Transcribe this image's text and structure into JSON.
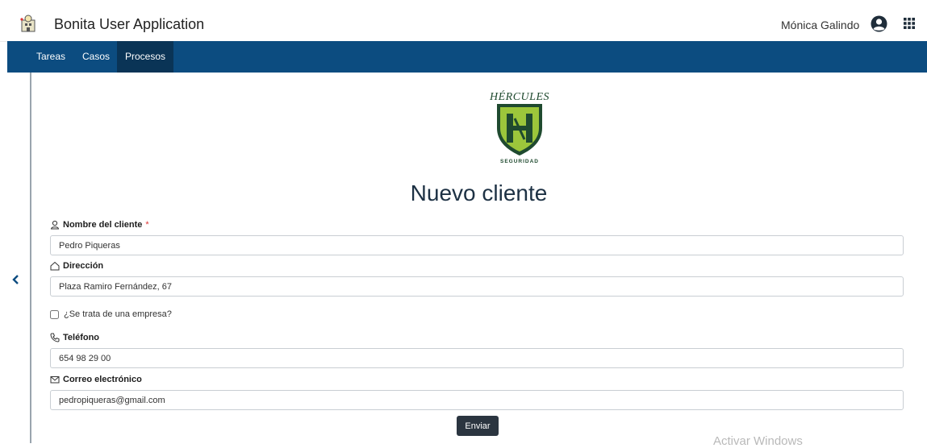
{
  "header": {
    "app_title": "Bonita User Application",
    "user_name": "Mónica Galindo"
  },
  "nav": {
    "items": [
      {
        "label": "Tareas"
      },
      {
        "label": "Casos"
      },
      {
        "label": "Procesos"
      }
    ],
    "active": "Procesos"
  },
  "logo": {
    "top_text": "HÉRCULES",
    "bottom_text": "SEGURIDAD",
    "colors": {
      "green": "#9cc63b",
      "dark": "#1f4a2f"
    }
  },
  "form": {
    "title": "Nuevo cliente",
    "fields": {
      "nombre": {
        "label": "Nombre del cliente",
        "required_mark": "*",
        "value": "Pedro Piqueras"
      },
      "direccion": {
        "label": "Dirección",
        "value": "Plaza Ramiro Fernández, 67"
      },
      "empresa": {
        "label": "¿Se trata de una empresa?"
      },
      "telefono": {
        "label": "Teléfono",
        "value": "654 98 29 00"
      },
      "correo": {
        "label": "Correo electrónico",
        "value": "pedropiqueras@gmail.com"
      }
    },
    "submit_label": "Enviar"
  },
  "watermark": "Activar Windows",
  "colors": {
    "navbar": "#0c4c80",
    "nav_active": "#0a3456",
    "button": "#2b3540"
  }
}
